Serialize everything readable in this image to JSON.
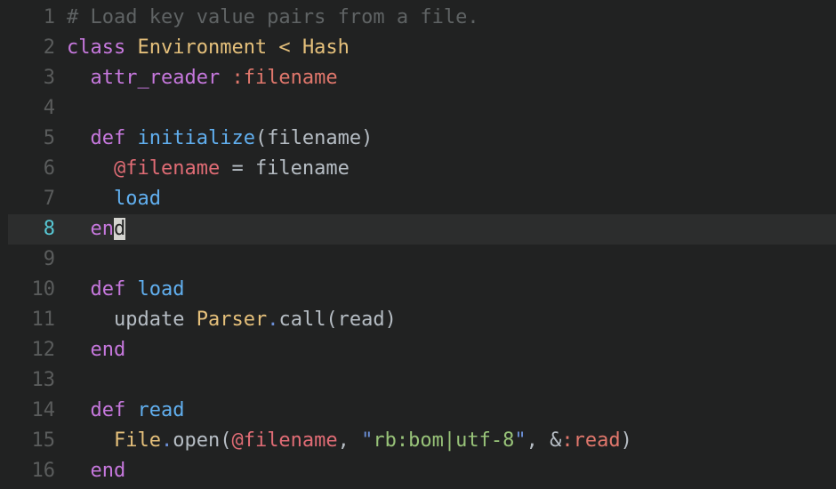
{
  "editor": {
    "theme_name": "one-dark",
    "language": "ruby",
    "background": "#212222",
    "active_line_background": "#2c2d2d",
    "gutter_color": "#5a5c5c",
    "active_gutter_color": "#57c7d4",
    "cursor_color": "#d4d4d0",
    "cursor_line": 8,
    "cursor_column": 6,
    "first_visible_line": 1,
    "last_visible_line": 16,
    "total_visible_lines": 16
  },
  "colors": {
    "comment": "#5f6364",
    "keyword": "#c678dd",
    "constant": "#e5c07b",
    "function": "#61afef",
    "instance_variable": "#e06c75",
    "symbol": "#e0776c",
    "plain": "#b6bdc4",
    "string": "#98c379",
    "quote": "#6b8fd6",
    "dot": "#6b8fd6"
  },
  "lines": [
    {
      "number": "1",
      "active": false,
      "raw": "# Load key value pairs from a file.",
      "tokens": [
        {
          "text": "# Load key value pairs from a file.",
          "cls": "t-comment"
        }
      ]
    },
    {
      "number": "2",
      "active": false,
      "raw": "class Environment < Hash",
      "tokens": [
        {
          "text": "class",
          "cls": "t-keyword"
        },
        {
          "text": " ",
          "cls": "t-plain"
        },
        {
          "text": "Environment",
          "cls": "t-class"
        },
        {
          "text": " < ",
          "cls": "t-class"
        },
        {
          "text": "Hash",
          "cls": "t-class"
        }
      ]
    },
    {
      "number": "3",
      "active": false,
      "raw": "  attr_reader :filename",
      "tokens": [
        {
          "text": "  ",
          "cls": "t-plain"
        },
        {
          "text": "attr_reader",
          "cls": "t-keyword"
        },
        {
          "text": " ",
          "cls": "t-plain"
        },
        {
          "text": ":filename",
          "cls": "t-symbol"
        }
      ]
    },
    {
      "number": "4",
      "active": false,
      "raw": "",
      "tokens": []
    },
    {
      "number": "5",
      "active": false,
      "raw": "  def initialize(filename)",
      "tokens": [
        {
          "text": "  ",
          "cls": "t-plain"
        },
        {
          "text": "def",
          "cls": "t-keyword"
        },
        {
          "text": " ",
          "cls": "t-plain"
        },
        {
          "text": "initialize",
          "cls": "t-func"
        },
        {
          "text": "(filename)",
          "cls": "t-plain"
        }
      ]
    },
    {
      "number": "6",
      "active": false,
      "raw": "    @filename = filename",
      "tokens": [
        {
          "text": "    ",
          "cls": "t-plain"
        },
        {
          "text": "@filename",
          "cls": "t-ivar"
        },
        {
          "text": " = filename",
          "cls": "t-plain"
        }
      ]
    },
    {
      "number": "7",
      "active": false,
      "raw": "    load",
      "tokens": [
        {
          "text": "    ",
          "cls": "t-plain"
        },
        {
          "text": "load",
          "cls": "t-method"
        }
      ]
    },
    {
      "number": "8",
      "active": true,
      "raw": "  end",
      "tokens": [
        {
          "text": "  ",
          "cls": "t-plain"
        },
        {
          "text": "en",
          "cls": "t-keyword"
        },
        {
          "text": "d",
          "cls": "t-keyword cursor-block"
        }
      ]
    },
    {
      "number": "9",
      "active": false,
      "raw": "",
      "tokens": []
    },
    {
      "number": "10",
      "active": false,
      "raw": "  def load",
      "tokens": [
        {
          "text": "  ",
          "cls": "t-plain"
        },
        {
          "text": "def",
          "cls": "t-keyword"
        },
        {
          "text": " ",
          "cls": "t-plain"
        },
        {
          "text": "load",
          "cls": "t-func"
        }
      ]
    },
    {
      "number": "11",
      "active": false,
      "raw": "    update Parser.call(read)",
      "tokens": [
        {
          "text": "    ",
          "cls": "t-plain"
        },
        {
          "text": "update",
          "cls": "t-plain"
        },
        {
          "text": " ",
          "cls": "t-plain"
        },
        {
          "text": "Parser",
          "cls": "t-const"
        },
        {
          "text": ".",
          "cls": "t-dot"
        },
        {
          "text": "call(read)",
          "cls": "t-plain"
        }
      ]
    },
    {
      "number": "12",
      "active": false,
      "raw": "  end",
      "tokens": [
        {
          "text": "  ",
          "cls": "t-plain"
        },
        {
          "text": "end",
          "cls": "t-keyword"
        }
      ]
    },
    {
      "number": "13",
      "active": false,
      "raw": "",
      "tokens": []
    },
    {
      "number": "14",
      "active": false,
      "raw": "  def read",
      "tokens": [
        {
          "text": "  ",
          "cls": "t-plain"
        },
        {
          "text": "def",
          "cls": "t-keyword"
        },
        {
          "text": " ",
          "cls": "t-plain"
        },
        {
          "text": "read",
          "cls": "t-func"
        }
      ]
    },
    {
      "number": "15",
      "active": false,
      "raw": "    File.open(@filename, \"rb:bom|utf-8\", &:read)",
      "tokens": [
        {
          "text": "    ",
          "cls": "t-plain"
        },
        {
          "text": "File",
          "cls": "t-const"
        },
        {
          "text": ".",
          "cls": "t-dot"
        },
        {
          "text": "open(",
          "cls": "t-plain"
        },
        {
          "text": "@filename",
          "cls": "t-ivar"
        },
        {
          "text": ", ",
          "cls": "t-plain"
        },
        {
          "text": "\"",
          "cls": "t-quote"
        },
        {
          "text": "rb:bom|utf-8",
          "cls": "t-string"
        },
        {
          "text": "\"",
          "cls": "t-quote"
        },
        {
          "text": ", &",
          "cls": "t-plain"
        },
        {
          "text": ":read",
          "cls": "t-symbol"
        },
        {
          "text": ")",
          "cls": "t-plain"
        }
      ]
    },
    {
      "number": "16",
      "active": false,
      "raw": "  end",
      "tokens": [
        {
          "text": "  ",
          "cls": "t-plain"
        },
        {
          "text": "end",
          "cls": "t-keyword"
        }
      ]
    }
  ]
}
